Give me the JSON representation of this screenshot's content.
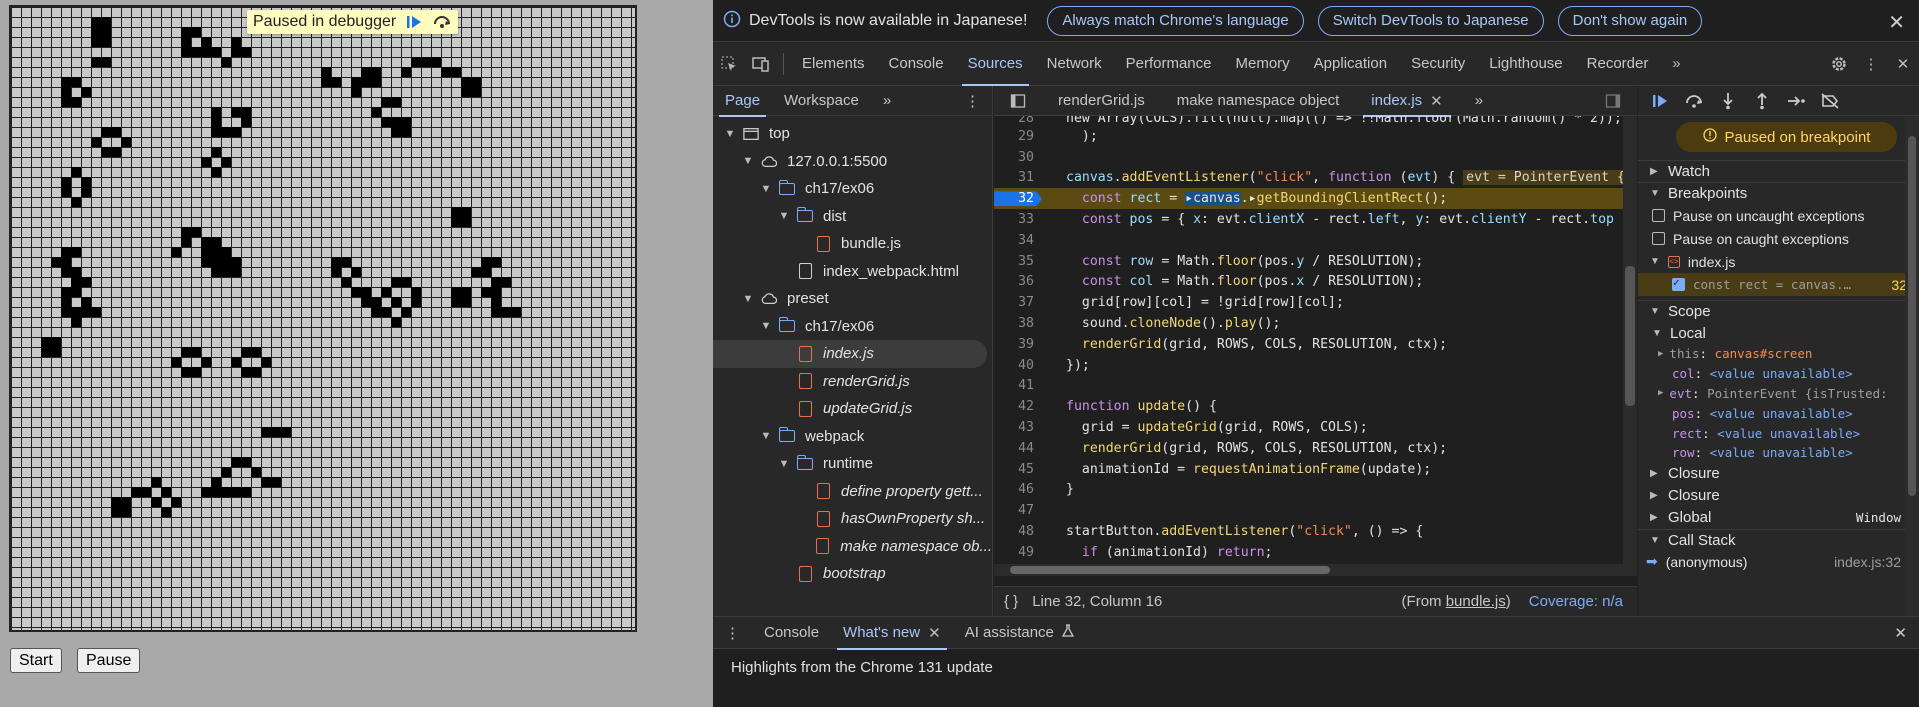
{
  "app": {
    "paused_text": "Paused in debugger",
    "start_label": "Start",
    "pause_label": "Pause",
    "live_cells": [
      [
        8,
        1
      ],
      [
        9,
        1
      ],
      [
        9,
        2
      ],
      [
        8,
        2
      ],
      [
        17,
        2
      ],
      [
        17,
        3
      ],
      [
        17,
        4
      ],
      [
        18,
        2
      ],
      [
        19,
        3
      ],
      [
        19,
        4
      ],
      [
        18,
        4
      ],
      [
        20,
        4
      ],
      [
        8,
        3
      ],
      [
        9,
        3
      ],
      [
        22,
        3
      ],
      [
        22,
        4
      ],
      [
        23,
        4
      ],
      [
        21,
        5
      ],
      [
        8,
        5
      ],
      [
        9,
        5
      ],
      [
        40,
        5
      ],
      [
        41,
        5
      ],
      [
        42,
        5
      ],
      [
        43,
        6
      ],
      [
        44,
        6
      ],
      [
        45,
        7
      ],
      [
        46,
        7
      ],
      [
        39,
        6
      ],
      [
        35,
        6
      ],
      [
        36,
        6
      ],
      [
        31,
        6
      ],
      [
        34,
        7
      ],
      [
        35,
        7
      ],
      [
        36,
        7
      ],
      [
        31,
        7
      ],
      [
        32,
        7
      ],
      [
        34,
        8
      ],
      [
        45,
        8
      ],
      [
        46,
        8
      ],
      [
        5,
        7
      ],
      [
        6,
        7
      ],
      [
        5,
        8
      ],
      [
        7,
        8
      ],
      [
        5,
        9
      ],
      [
        6,
        9
      ],
      [
        37,
        9
      ],
      [
        38,
        9
      ],
      [
        36,
        10
      ],
      [
        37,
        11
      ],
      [
        38,
        11
      ],
      [
        38,
        12
      ],
      [
        39,
        12
      ],
      [
        39,
        11
      ],
      [
        20,
        10
      ],
      [
        22,
        10
      ],
      [
        23,
        10
      ],
      [
        20,
        11
      ],
      [
        23,
        11
      ],
      [
        20,
        12
      ],
      [
        21,
        12
      ],
      [
        22,
        12
      ],
      [
        9,
        12
      ],
      [
        10,
        12
      ],
      [
        8,
        13
      ],
      [
        11,
        13
      ],
      [
        9,
        14
      ],
      [
        10,
        14
      ],
      [
        20,
        14
      ],
      [
        19,
        15
      ],
      [
        21,
        15
      ],
      [
        20,
        16
      ],
      [
        6,
        16
      ],
      [
        5,
        17
      ],
      [
        7,
        17
      ],
      [
        5,
        18
      ],
      [
        7,
        18
      ],
      [
        6,
        19
      ],
      [
        44,
        20
      ],
      [
        45,
        20
      ],
      [
        44,
        21
      ],
      [
        45,
        21
      ],
      [
        17,
        22
      ],
      [
        18,
        22
      ],
      [
        17,
        23
      ],
      [
        19,
        23
      ],
      [
        20,
        23
      ],
      [
        16,
        24
      ],
      [
        19,
        24
      ],
      [
        20,
        24
      ],
      [
        21,
        24
      ],
      [
        19,
        25
      ],
      [
        20,
        25
      ],
      [
        21,
        25
      ],
      [
        22,
        25
      ],
      [
        20,
        26
      ],
      [
        21,
        26
      ],
      [
        22,
        26
      ],
      [
        5,
        24
      ],
      [
        6,
        24
      ],
      [
        4,
        25
      ],
      [
        5,
        25
      ],
      [
        6,
        26
      ],
      [
        5,
        26
      ],
      [
        32,
        25
      ],
      [
        33,
        25
      ],
      [
        32,
        26
      ],
      [
        34,
        26
      ],
      [
        33,
        27
      ],
      [
        34,
        28
      ],
      [
        35,
        28
      ],
      [
        36,
        29
      ],
      [
        35,
        29
      ],
      [
        36,
        30
      ],
      [
        47,
        25
      ],
      [
        48,
        25
      ],
      [
        47,
        26
      ],
      [
        46,
        26
      ],
      [
        48,
        27
      ],
      [
        49,
        27
      ],
      [
        47,
        28
      ],
      [
        48,
        28
      ],
      [
        48,
        29
      ],
      [
        49,
        30
      ],
      [
        50,
        30
      ],
      [
        48,
        30
      ],
      [
        38,
        27
      ],
      [
        39,
        27
      ],
      [
        37,
        28
      ],
      [
        40,
        28
      ],
      [
        38,
        29
      ],
      [
        40,
        29
      ],
      [
        37,
        30
      ],
      [
        39,
        30
      ],
      [
        38,
        31
      ],
      [
        44,
        28
      ],
      [
        45,
        28
      ],
      [
        44,
        29
      ],
      [
        45,
        29
      ],
      [
        6,
        27
      ],
      [
        7,
        27
      ],
      [
        5,
        28
      ],
      [
        6,
        28
      ],
      [
        5,
        29
      ],
      [
        7,
        29
      ],
      [
        6,
        30
      ],
      [
        7,
        30
      ],
      [
        8,
        30
      ],
      [
        5,
        30
      ],
      [
        6,
        31
      ],
      [
        3,
        33
      ],
      [
        4,
        33
      ],
      [
        3,
        34
      ],
      [
        4,
        34
      ],
      [
        17,
        34
      ],
      [
        18,
        34
      ],
      [
        16,
        35
      ],
      [
        19,
        35
      ],
      [
        17,
        36
      ],
      [
        18,
        36
      ],
      [
        23,
        34
      ],
      [
        24,
        34
      ],
      [
        22,
        35
      ],
      [
        25,
        35
      ],
      [
        23,
        36
      ],
      [
        24,
        36
      ],
      [
        25,
        42
      ],
      [
        26,
        42
      ],
      [
        27,
        42
      ],
      [
        22,
        45
      ],
      [
        23,
        45
      ],
      [
        21,
        46
      ],
      [
        24,
        46
      ],
      [
        20,
        47
      ],
      [
        25,
        47
      ],
      [
        26,
        47
      ],
      [
        19,
        48
      ],
      [
        20,
        48
      ],
      [
        21,
        48
      ],
      [
        22,
        48
      ],
      [
        23,
        48
      ],
      [
        14,
        47
      ],
      [
        15,
        48
      ],
      [
        14,
        49
      ],
      [
        16,
        49
      ],
      [
        15,
        50
      ],
      [
        10,
        49
      ],
      [
        11,
        49
      ],
      [
        10,
        50
      ],
      [
        11,
        50
      ],
      [
        12,
        48
      ],
      [
        13,
        48
      ]
    ]
  },
  "devtools": {
    "infobar": {
      "message": "DevTools is now available in Japanese!",
      "btn_match": "Always match Chrome's language",
      "btn_switch": "Switch DevTools to Japanese",
      "btn_dismiss": "Don't show again"
    },
    "tabs": [
      "Elements",
      "Console",
      "Sources",
      "Network",
      "Performance",
      "Memory",
      "Application",
      "Security",
      "Lighthouse",
      "Recorder"
    ],
    "navigator": {
      "tab_page": "Page",
      "tab_workspace": "Workspace",
      "tree": [
        {
          "label": "top",
          "depth": 0,
          "icon": "frame",
          "arrow": "▼"
        },
        {
          "label": "127.0.0.1:5500",
          "depth": 1,
          "icon": "cloud",
          "arrow": "▼"
        },
        {
          "label": "ch17/ex06",
          "depth": 2,
          "icon": "folder",
          "arrow": "▼"
        },
        {
          "label": "dist",
          "depth": 3,
          "icon": "folder",
          "arrow": "▼"
        },
        {
          "label": "bundle.js",
          "depth": 4,
          "icon": "file",
          "arrow": ""
        },
        {
          "label": "index_webpack.html",
          "depth": 3,
          "icon": "file-plain",
          "arrow": ""
        },
        {
          "label": "preset",
          "depth": 1,
          "icon": "cloud",
          "arrow": "▼"
        },
        {
          "label": "ch17/ex06",
          "depth": 2,
          "icon": "folder",
          "arrow": "▼"
        },
        {
          "label": "index.js",
          "depth": 3,
          "icon": "file",
          "arrow": "",
          "italic": true,
          "selected": true
        },
        {
          "label": "renderGrid.js",
          "depth": 3,
          "icon": "file",
          "arrow": "",
          "italic": true
        },
        {
          "label": "updateGrid.js",
          "depth": 3,
          "icon": "file",
          "arrow": "",
          "italic": true
        },
        {
          "label": "webpack",
          "depth": 2,
          "icon": "folder",
          "arrow": "▼"
        },
        {
          "label": "runtime",
          "depth": 3,
          "icon": "folder",
          "arrow": "▼"
        },
        {
          "label": "define property gett...",
          "depth": 4,
          "icon": "file",
          "arrow": "",
          "italic": true
        },
        {
          "label": "hasOwnProperty sh...",
          "depth": 4,
          "icon": "file",
          "arrow": "",
          "italic": true
        },
        {
          "label": "make namespace ob...",
          "depth": 4,
          "icon": "file",
          "arrow": "",
          "italic": true
        },
        {
          "label": "bootstrap",
          "depth": 3,
          "icon": "file",
          "arrow": "",
          "italic": true
        }
      ]
    },
    "editor": {
      "tabs": [
        "renderGrid.js",
        "make namespace object",
        "index.js"
      ],
      "status_position": "Line 32, Column 16",
      "status_from_prefix": "(From ",
      "status_from_file": "bundle.js",
      "status_from_suffix": ")",
      "status_coverage": "Coverage: n/a"
    },
    "debugger": {
      "paused_banner": "Paused on breakpoint",
      "watch": "Watch",
      "breakpoints": "Breakpoints",
      "pause_uncaught": "Pause on uncaught exceptions",
      "pause_caught": "Pause on caught exceptions",
      "bp_file": "index.js",
      "bp_code": "const rect = canvas.…",
      "bp_line": "32",
      "scope": "Scope",
      "local": "Local",
      "closure1": "Closure",
      "closure2": "Closure",
      "global": "Global",
      "global_value": "Window",
      "call_stack": "Call Stack",
      "cs_fn": "(anonymous)",
      "cs_loc": "index.js:32"
    },
    "drawer": {
      "tab_console": "Console",
      "tab_whatsnew": "What's new",
      "tab_ai": "AI assistance",
      "body": "Highlights from the Chrome 131 update"
    }
  }
}
